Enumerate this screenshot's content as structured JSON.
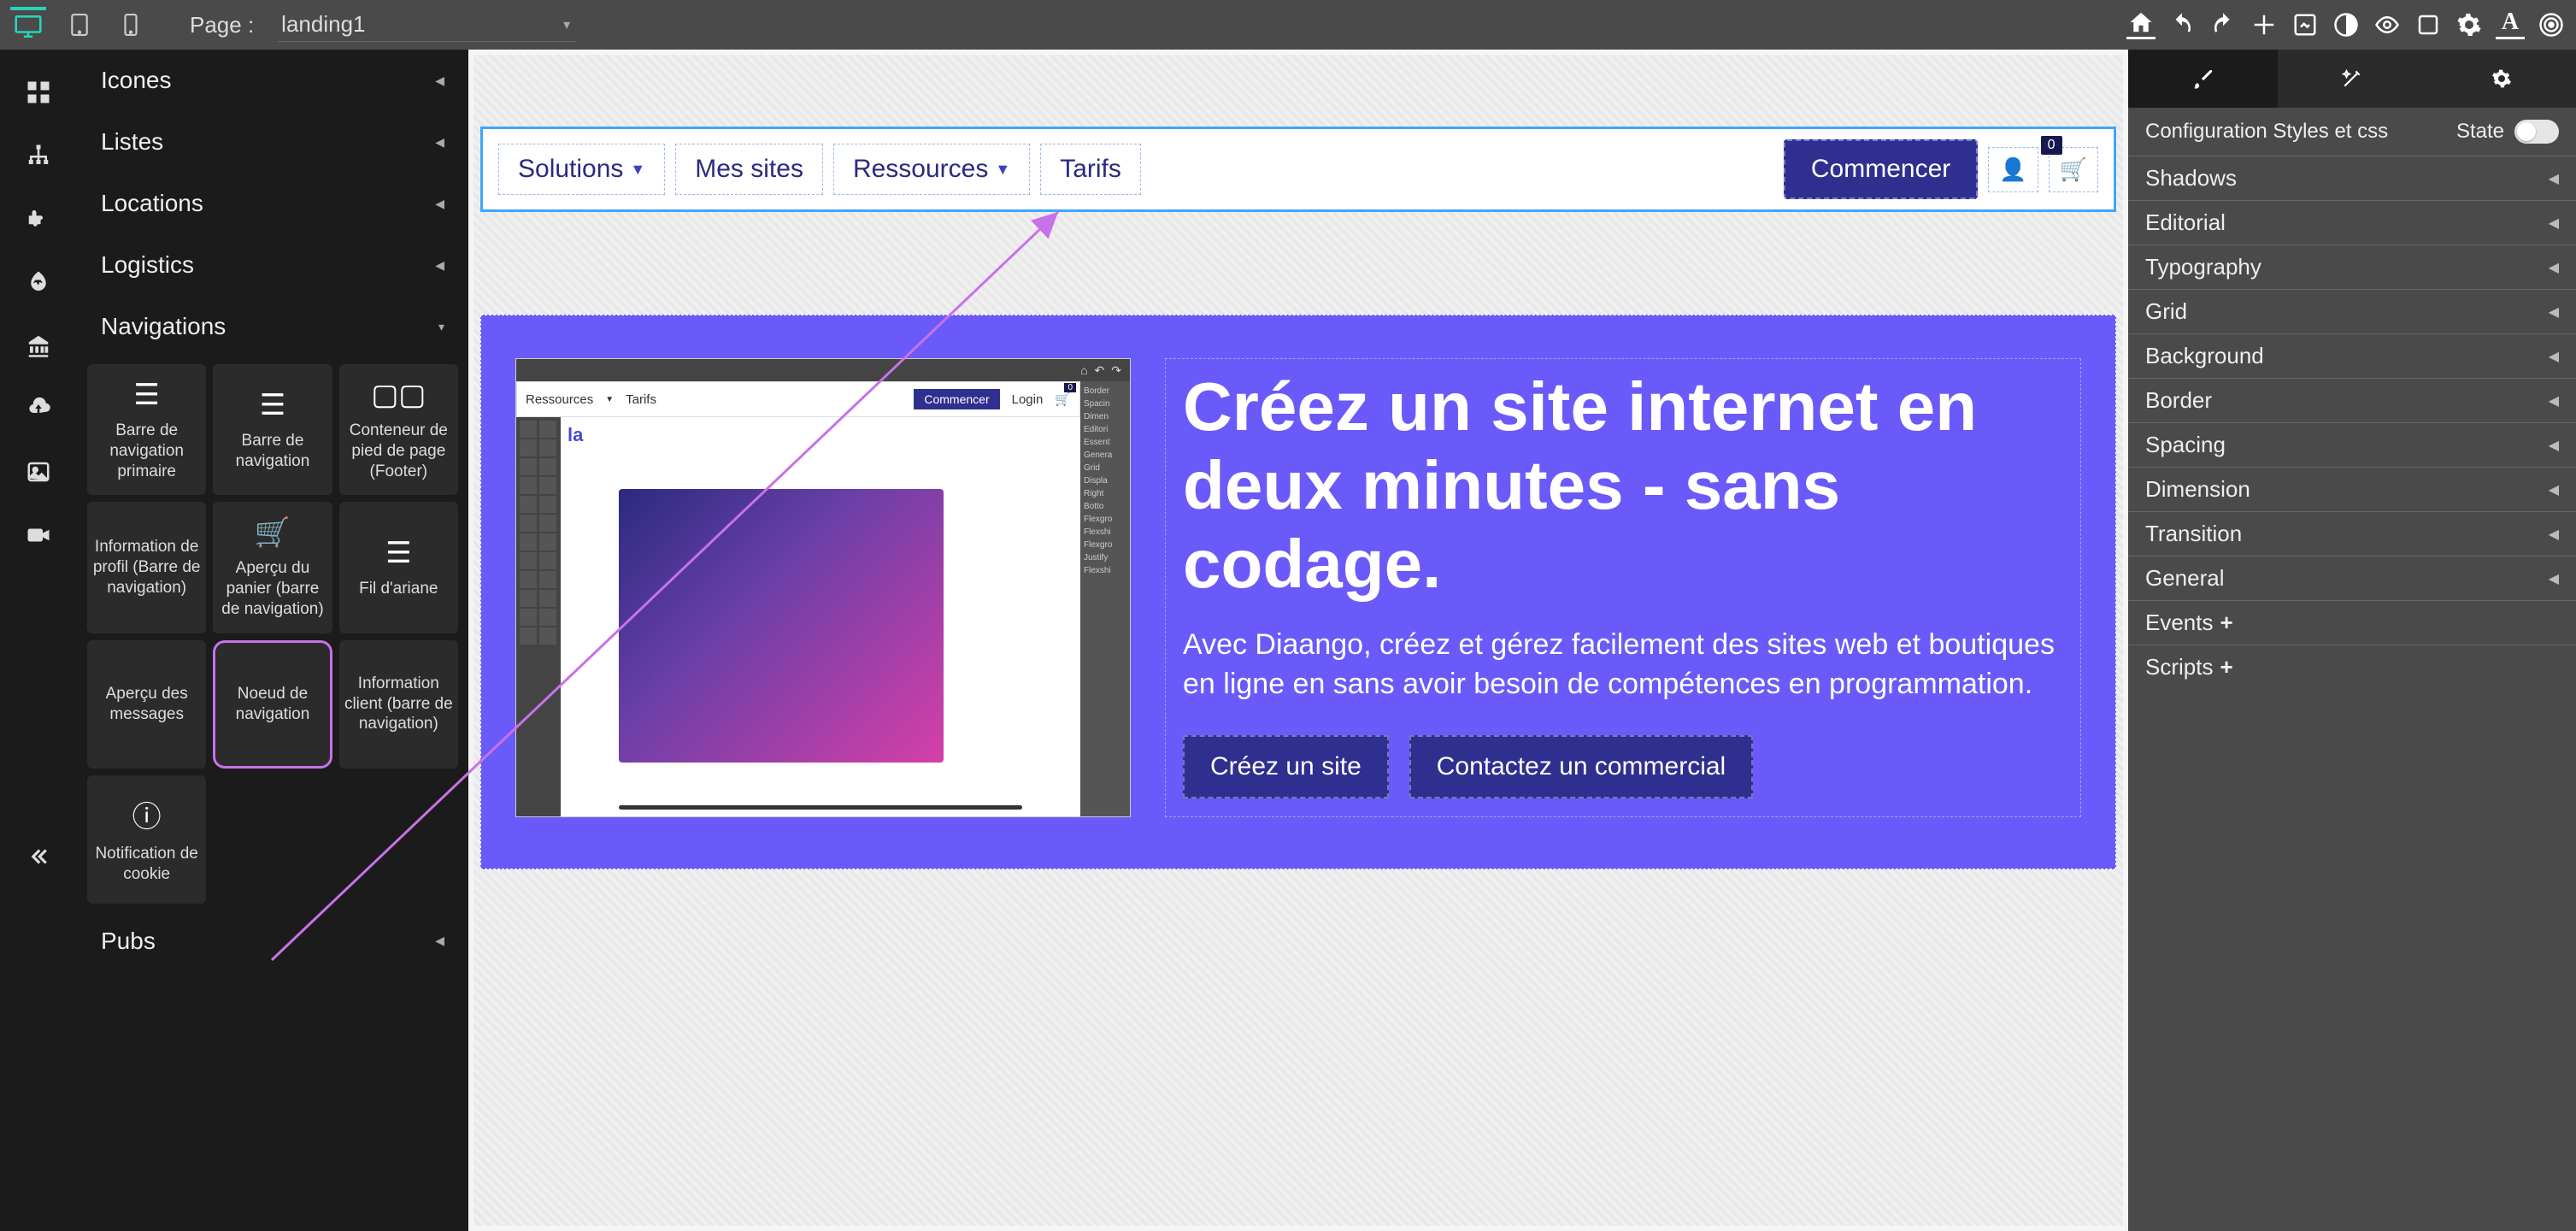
{
  "topbar": {
    "page_label": "Page :",
    "page_value": "landing1"
  },
  "categories": {
    "icones": "Icones",
    "listes": "Listes",
    "locations": "Locations",
    "logistics": "Logistics",
    "navigations": "Navigations",
    "pubs": "Pubs"
  },
  "nav_tiles": {
    "primary_nav": "Barre de navigation primaire",
    "navbar": "Barre de navigation",
    "footer": "Conteneur de pied de page (Footer)",
    "profile_info": "Information de profil (Barre de navigation)",
    "cart_preview": "Aperçu du panier (barre de navigation)",
    "breadcrumb": "Fil d'ariane",
    "msg_preview": "Aperçu des messages",
    "nav_node": "Noeud de navigation",
    "client_info": "Information client (barre de navigation)",
    "cookie_notice": "Notification de cookie"
  },
  "site_nav": {
    "solutions": "Solutions",
    "mes_sites": "Mes sites",
    "ressources": "Ressources",
    "tarifs": "Tarifs",
    "commencer": "Commencer",
    "cart_count": "0"
  },
  "mini_nav": {
    "ressources": "Ressources",
    "tarifs": "Tarifs",
    "commencer": "Commencer",
    "login": "Login"
  },
  "hero": {
    "title": "Créez un site internet en deux minutes - sans codage.",
    "subtitle": "Avec Diaango, créez et gérez facilement des sites web et boutiques en ligne en sans avoir besoin de compétences en programmation.",
    "btn_create": "Créez un site",
    "btn_contact": "Contactez un commercial"
  },
  "mini_right": {
    "r0": "Border",
    "r1": "Spacin",
    "r2": "Dimen",
    "r3": "Editori",
    "r4": "Essent",
    "r5": "Genera",
    "r6": "Grid",
    "r7": "Displa",
    "r8": "Right",
    "r9": "Botto",
    "r10": "Flexgro",
    "r11": "Flexshi",
    "r12": "Flexgro",
    "r13": "Justify",
    "r14": "Flexshi"
  },
  "props": {
    "config_label": "Configuration Styles et css",
    "state_label": "State",
    "shadows": "Shadows",
    "editorial": "Editorial",
    "typography": "Typography",
    "grid": "Grid",
    "background": "Background",
    "border": "Border",
    "spacing": "Spacing",
    "dimension": "Dimension",
    "transition": "Transition",
    "general": "General",
    "events": "Events",
    "scripts": "Scripts"
  }
}
